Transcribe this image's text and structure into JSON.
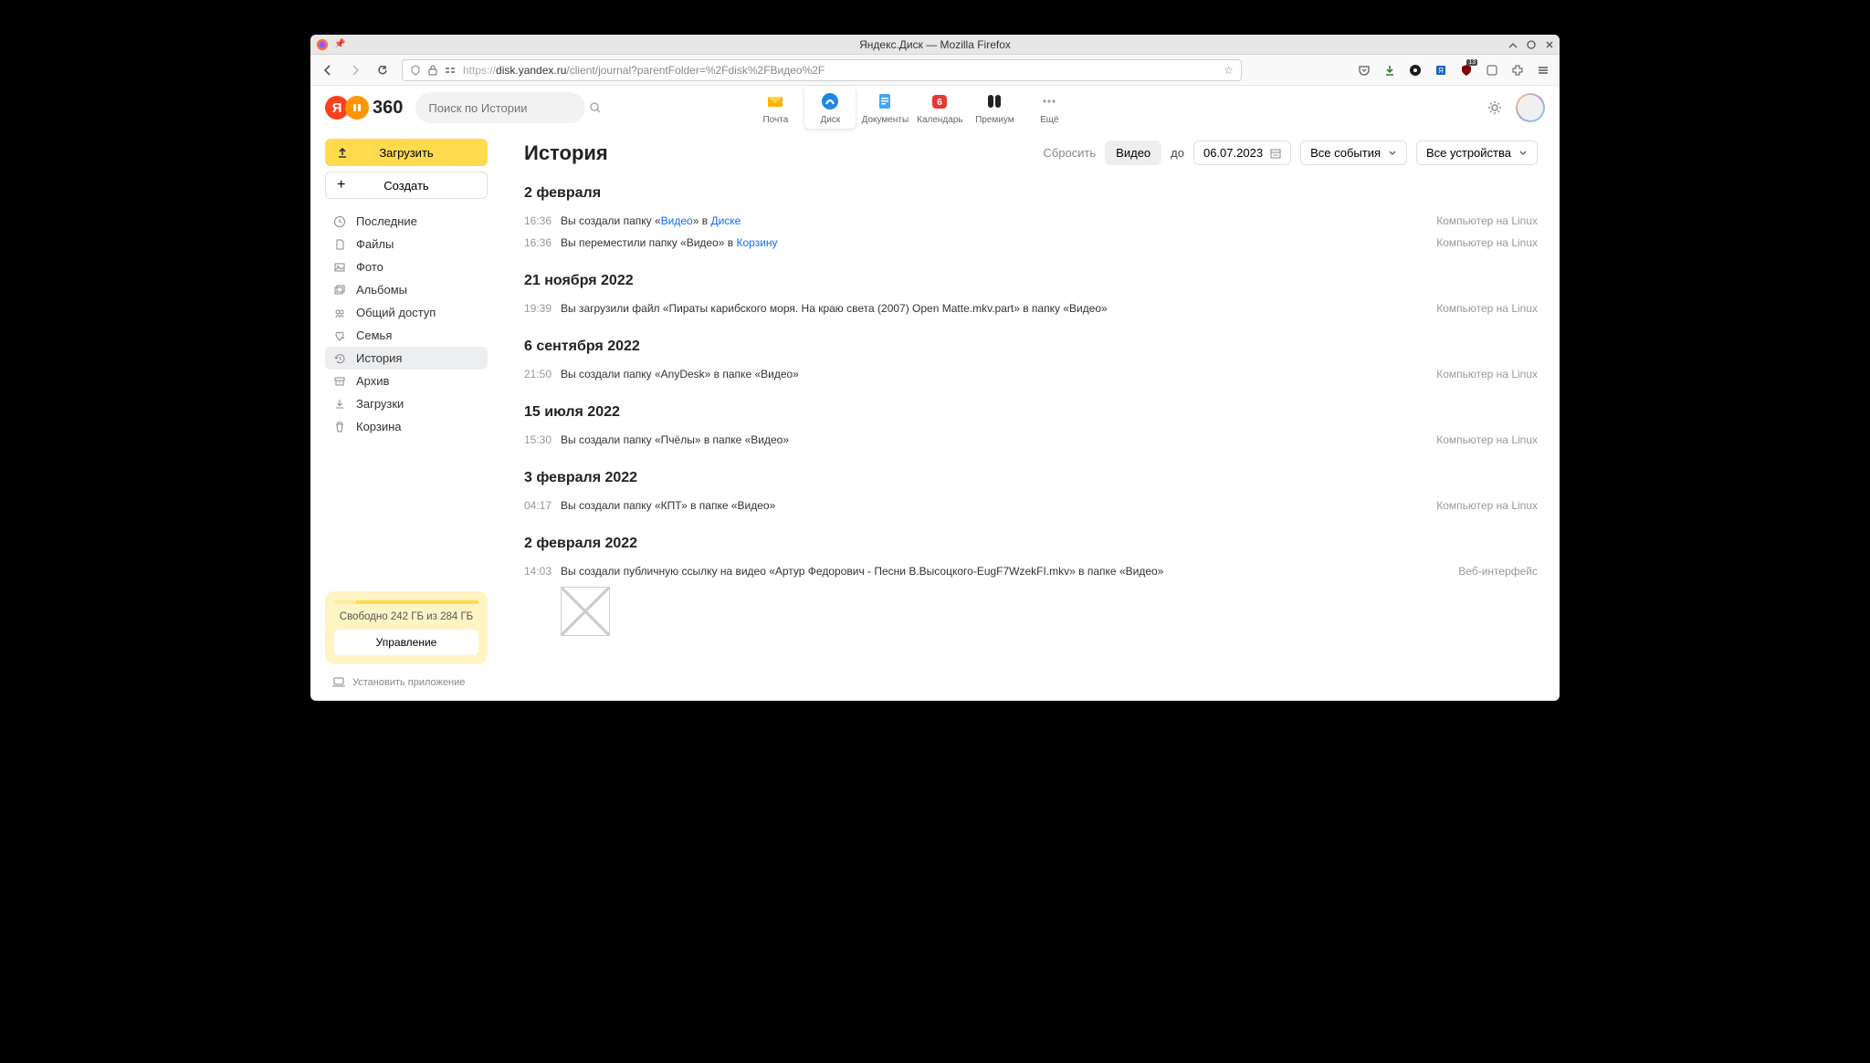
{
  "window": {
    "title": "Яндекс.Диск — Mozilla Firefox"
  },
  "url": {
    "protocol": "https://",
    "host": "disk.yandex.ru",
    "path": "/client/journal?parentFolder=%2Fdisk%2FВидео%2F"
  },
  "header": {
    "logo_text": "360",
    "search_placeholder": "Поиск по Истории",
    "apps": [
      {
        "label": "Почта",
        "color": "#ffb300"
      },
      {
        "label": "Диск",
        "color": "#2196f3",
        "active": true
      },
      {
        "label": "Документы",
        "color": "#42a5f5",
        "badge": ""
      },
      {
        "label": "Календарь",
        "color": "#f44336",
        "badge": "6"
      },
      {
        "label": "Премиум",
        "color": "#212121"
      },
      {
        "label": "Ещё",
        "color": "#9e9e9e"
      }
    ]
  },
  "sidebar": {
    "upload": "Загрузить",
    "create": "Создать",
    "items": [
      {
        "label": "Последние",
        "icon": "clock"
      },
      {
        "label": "Файлы",
        "icon": "file"
      },
      {
        "label": "Фото",
        "icon": "image"
      },
      {
        "label": "Альбомы",
        "icon": "album"
      },
      {
        "label": "Общий доступ",
        "icon": "share"
      },
      {
        "label": "Семья",
        "icon": "heart"
      },
      {
        "label": "История",
        "icon": "history",
        "active": true
      },
      {
        "label": "Архив",
        "icon": "archive"
      },
      {
        "label": "Загрузки",
        "icon": "download"
      },
      {
        "label": "Корзина",
        "icon": "trash"
      }
    ],
    "storage": {
      "text": "Свободно 242 ГБ из 284 ГБ",
      "manage": "Управление"
    },
    "install": "Установить приложение"
  },
  "main": {
    "title": "История",
    "filters": {
      "reset": "Сбросить",
      "type": "Видео",
      "to_label": "до",
      "date": "06.07.2023",
      "events": "Все события",
      "devices": "Все устройства"
    },
    "groups": [
      {
        "date": "2 февраля",
        "events": [
          {
            "time": "16:36",
            "text": "Вы создали папку «",
            "link1": "Видео",
            "mid": "» в ",
            "link2": "Диске",
            "device": "Компьютер на Linux"
          },
          {
            "time": "16:36",
            "text": "Вы переместили папку «Видео» в ",
            "link1": "Корзину",
            "device": "Компьютер на Linux"
          }
        ]
      },
      {
        "date": "21 ноября 2022",
        "events": [
          {
            "time": "19:39",
            "text": "Вы загрузили файл «Пираты карибского моря. На краю света (2007) Open Matte.mkv.part» в папку «Видео»",
            "device": "Компьютер на Linux"
          }
        ]
      },
      {
        "date": "6 сентября 2022",
        "events": [
          {
            "time": "21:50",
            "text": "Вы создали папку «AnyDesk» в папке «Видео»",
            "device": "Компьютер на Linux"
          }
        ]
      },
      {
        "date": "15 июля 2022",
        "events": [
          {
            "time": "15:30",
            "text": "Вы создали папку «Пчёлы» в папке «Видео»",
            "device": "Компьютер на Linux"
          }
        ]
      },
      {
        "date": "3 февраля 2022",
        "events": [
          {
            "time": "04:17",
            "text": "Вы создали папку «КПТ» в папке «Видео»",
            "device": "Компьютер на Linux"
          }
        ]
      },
      {
        "date": "2 февраля 2022",
        "events": [
          {
            "time": "14:03",
            "text": "Вы создали публичную ссылку на видео «Артур Федорович - Песни В.Высоцкого-EugF7WzekFI.mkv» в папке «Видео»",
            "device": "Веб-интерфейс",
            "thumb": true
          }
        ]
      }
    ]
  },
  "ext_badge": "13"
}
